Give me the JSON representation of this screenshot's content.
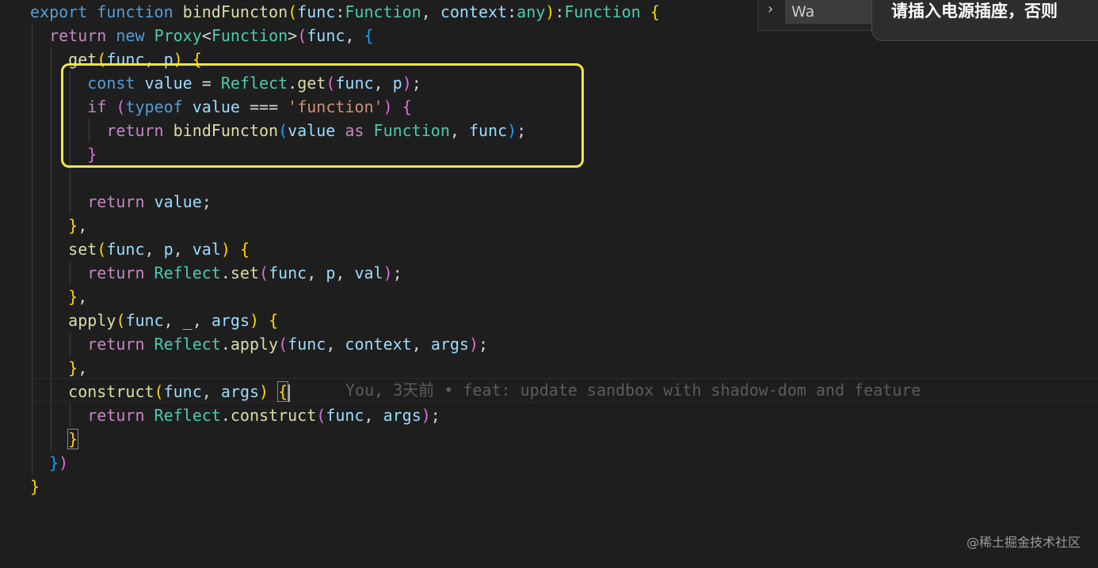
{
  "colors": {
    "background": "#1e1e1e",
    "keyword": "#569cd6",
    "control": "#c586c0",
    "function": "#dcdcaa",
    "type": "#4ec9b0",
    "variable": "#9cdcfe",
    "string": "#ce9178",
    "highlight_box": "#f5e34a"
  },
  "editor": {
    "lines": [
      [
        [
          "export",
          "kw"
        ],
        [
          " ",
          "pl"
        ],
        [
          "function",
          "kw"
        ],
        [
          " ",
          "pl"
        ],
        [
          "bindFuncton",
          "fn"
        ],
        [
          "(",
          "b1"
        ],
        [
          "func",
          "var"
        ],
        [
          ":",
          "pl"
        ],
        [
          "Function",
          "ty"
        ],
        [
          ", ",
          "pl"
        ],
        [
          "context",
          "var"
        ],
        [
          ":",
          "pl"
        ],
        [
          "any",
          "ty"
        ],
        [
          ")",
          "b1"
        ],
        [
          ":",
          "pl"
        ],
        [
          "Function",
          "ty"
        ],
        [
          " ",
          "pl"
        ],
        [
          "{",
          "b1"
        ]
      ],
      [
        [
          "  ",
          "pl"
        ],
        [
          "return",
          "ctl"
        ],
        [
          " ",
          "pl"
        ],
        [
          "new",
          "kw"
        ],
        [
          " ",
          "pl"
        ],
        [
          "Proxy",
          "ty"
        ],
        [
          "<",
          "pl"
        ],
        [
          "Function",
          "ty"
        ],
        [
          ">",
          "pl"
        ],
        [
          "(",
          "b2"
        ],
        [
          "func",
          "var"
        ],
        [
          ", ",
          "pl"
        ],
        [
          "{",
          "b3"
        ]
      ],
      [
        [
          "    ",
          "pl"
        ],
        [
          "get",
          "fn"
        ],
        [
          "(",
          "b1"
        ],
        [
          "func",
          "var"
        ],
        [
          ", ",
          "pl"
        ],
        [
          "p",
          "var"
        ],
        [
          ")",
          "b1"
        ],
        [
          " ",
          "pl"
        ],
        [
          "{",
          "b1"
        ]
      ],
      [
        [
          "      ",
          "pl"
        ],
        [
          "const",
          "kw"
        ],
        [
          " ",
          "pl"
        ],
        [
          "value",
          "var"
        ],
        [
          " = ",
          "pl"
        ],
        [
          "Reflect",
          "ty"
        ],
        [
          ".",
          "pl"
        ],
        [
          "get",
          "fn"
        ],
        [
          "(",
          "b2"
        ],
        [
          "func",
          "var"
        ],
        [
          ", ",
          "pl"
        ],
        [
          "p",
          "var"
        ],
        [
          ")",
          "b2"
        ],
        [
          ";",
          "pl"
        ]
      ],
      [
        [
          "      ",
          "pl"
        ],
        [
          "if",
          "ctl"
        ],
        [
          " ",
          "pl"
        ],
        [
          "(",
          "b2"
        ],
        [
          "typeof",
          "kw"
        ],
        [
          " ",
          "pl"
        ],
        [
          "value",
          "var"
        ],
        [
          " === ",
          "pl"
        ],
        [
          "'function'",
          "str"
        ],
        [
          ")",
          "b2"
        ],
        [
          " ",
          "pl"
        ],
        [
          "{",
          "b2"
        ]
      ],
      [
        [
          "        ",
          "pl"
        ],
        [
          "return",
          "ctl"
        ],
        [
          " ",
          "pl"
        ],
        [
          "bindFuncton",
          "fn"
        ],
        [
          "(",
          "b3"
        ],
        [
          "value",
          "var"
        ],
        [
          " ",
          "pl"
        ],
        [
          "as",
          "ctl"
        ],
        [
          " ",
          "pl"
        ],
        [
          "Function",
          "ty"
        ],
        [
          ", ",
          "pl"
        ],
        [
          "func",
          "var"
        ],
        [
          ")",
          "b3"
        ],
        [
          ";",
          "pl"
        ]
      ],
      [
        [
          "      ",
          "pl"
        ],
        [
          "}",
          "b2"
        ]
      ],
      [
        [
          "",
          "pl"
        ]
      ],
      [
        [
          "      ",
          "pl"
        ],
        [
          "return",
          "ctl"
        ],
        [
          " ",
          "pl"
        ],
        [
          "value",
          "var"
        ],
        [
          ";",
          "pl"
        ]
      ],
      [
        [
          "    ",
          "pl"
        ],
        [
          "}",
          "b1"
        ],
        [
          ",",
          "pl"
        ]
      ],
      [
        [
          "    ",
          "pl"
        ],
        [
          "set",
          "fn"
        ],
        [
          "(",
          "b1"
        ],
        [
          "func",
          "var"
        ],
        [
          ", ",
          "pl"
        ],
        [
          "p",
          "var"
        ],
        [
          ", ",
          "pl"
        ],
        [
          "val",
          "var"
        ],
        [
          ")",
          "b1"
        ],
        [
          " ",
          "pl"
        ],
        [
          "{",
          "b1"
        ]
      ],
      [
        [
          "      ",
          "pl"
        ],
        [
          "return",
          "ctl"
        ],
        [
          " ",
          "pl"
        ],
        [
          "Reflect",
          "ty"
        ],
        [
          ".",
          "pl"
        ],
        [
          "set",
          "fn"
        ],
        [
          "(",
          "b2"
        ],
        [
          "func",
          "var"
        ],
        [
          ", ",
          "pl"
        ],
        [
          "p",
          "var"
        ],
        [
          ", ",
          "pl"
        ],
        [
          "val",
          "var"
        ],
        [
          ")",
          "b2"
        ],
        [
          ";",
          "pl"
        ]
      ],
      [
        [
          "    ",
          "pl"
        ],
        [
          "}",
          "b1"
        ],
        [
          ",",
          "pl"
        ]
      ],
      [
        [
          "    ",
          "pl"
        ],
        [
          "apply",
          "fn"
        ],
        [
          "(",
          "b1"
        ],
        [
          "func",
          "var"
        ],
        [
          ", ",
          "pl"
        ],
        [
          "_",
          "var"
        ],
        [
          ", ",
          "pl"
        ],
        [
          "args",
          "var"
        ],
        [
          ")",
          "b1"
        ],
        [
          " ",
          "pl"
        ],
        [
          "{",
          "b1"
        ]
      ],
      [
        [
          "      ",
          "pl"
        ],
        [
          "return",
          "ctl"
        ],
        [
          " ",
          "pl"
        ],
        [
          "Reflect",
          "ty"
        ],
        [
          ".",
          "pl"
        ],
        [
          "apply",
          "fn"
        ],
        [
          "(",
          "b2"
        ],
        [
          "func",
          "var"
        ],
        [
          ", ",
          "pl"
        ],
        [
          "context",
          "var"
        ],
        [
          ", ",
          "pl"
        ],
        [
          "args",
          "var"
        ],
        [
          ")",
          "b2"
        ],
        [
          ";",
          "pl"
        ]
      ],
      [
        [
          "    ",
          "pl"
        ],
        [
          "}",
          "b1"
        ],
        [
          ",",
          "pl"
        ]
      ],
      [
        [
          "    ",
          "pl"
        ],
        [
          "construct",
          "fn"
        ],
        [
          "(",
          "b1"
        ],
        [
          "func",
          "var"
        ],
        [
          ", ",
          "pl"
        ],
        [
          "args",
          "var"
        ],
        [
          ")",
          "b1"
        ],
        [
          " ",
          "pl"
        ],
        [
          "{",
          "b1 bracket-match"
        ]
      ],
      [
        [
          "      ",
          "pl"
        ],
        [
          "return",
          "ctl"
        ],
        [
          " ",
          "pl"
        ],
        [
          "Reflect",
          "ty"
        ],
        [
          ".",
          "pl"
        ],
        [
          "construct",
          "fn"
        ],
        [
          "(",
          "b2"
        ],
        [
          "func",
          "var"
        ],
        [
          ", ",
          "pl"
        ],
        [
          "args",
          "var"
        ],
        [
          ")",
          "b2"
        ],
        [
          ";",
          "pl"
        ]
      ],
      [
        [
          "    ",
          "pl"
        ],
        [
          "}",
          "b1 bracket-match"
        ]
      ],
      [
        [
          "  ",
          "pl"
        ],
        [
          "}",
          "b3"
        ],
        [
          ")",
          "b2"
        ]
      ],
      [
        [
          "",
          "pl"
        ],
        [
          "}",
          "b1"
        ]
      ]
    ],
    "blame_annotation": "You, 3天前 • feat: update sandbox with shadow-dom and feature"
  },
  "search": {
    "value": "Wa",
    "expand_icon": "chevron-right-icon"
  },
  "notification": {
    "text": "请插入电源插座，否则"
  },
  "watermark": {
    "text": "@稀土掘金技术社区"
  }
}
